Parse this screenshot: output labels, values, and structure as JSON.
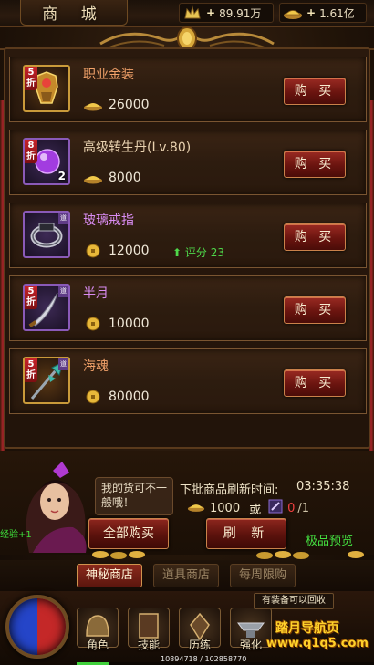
{
  "header": {
    "title": "商 城",
    "vip_currency": "89.91万",
    "gold_currency": "1.61亿"
  },
  "items": [
    {
      "name": "职业金装",
      "price": "26000",
      "currency": "gold-ingot",
      "discount": "5折",
      "rarity": "gold",
      "buy_label": "购 买"
    },
    {
      "name": "高级转生丹(Lv.80)",
      "price": "8000",
      "currency": "gold-ingot",
      "discount": "8折",
      "quantity": "2",
      "rarity": "purple",
      "buy_label": "购 买"
    },
    {
      "name": "玻璃戒指",
      "price": "12000",
      "currency": "gold-coin",
      "bound_tag": "道",
      "score": "评分 23",
      "rarity": "purple",
      "buy_label": "购 买"
    },
    {
      "name": "半月",
      "price": "10000",
      "currency": "gold-coin",
      "discount": "5折",
      "bound_tag": "道",
      "rarity": "purple",
      "buy_label": "购 买"
    },
    {
      "name": "海魂",
      "price": "80000",
      "currency": "gold-coin",
      "discount": "5折",
      "bound_tag": "道",
      "rarity": "gold",
      "buy_label": "购 买"
    }
  ],
  "npc": {
    "speech": "我的货可不一般哦！"
  },
  "refresh": {
    "label": "下批商品刷新时间:",
    "countdown": "03:35:38",
    "cost_gold": "1000",
    "or_label": "或",
    "token_have": "0",
    "token_need": "/1"
  },
  "buttons": {
    "buy_all": "全部购买",
    "refresh": "刷 新",
    "preview": "极品预览"
  },
  "exp_label": "经验+1",
  "tabs": [
    {
      "label": "神秘商店",
      "active": true
    },
    {
      "label": "道具商店",
      "active": false
    },
    {
      "label": "每周限购",
      "active": false
    }
  ],
  "hud": {
    "tooltip": "有装备可以回收",
    "skills": [
      "角色",
      "技能",
      "历练",
      "强化"
    ],
    "exp_readout": "10894718 / 102858770",
    "exp_fraction": 0.106
  },
  "watermark": {
    "line1": "踏月导航页",
    "line2": "www.q1q5.com"
  },
  "colors": {
    "accent_red": "#8d261e",
    "border_gold": "#c9824a",
    "green_text": "#44e040",
    "purple_name": "#d98cf2"
  }
}
